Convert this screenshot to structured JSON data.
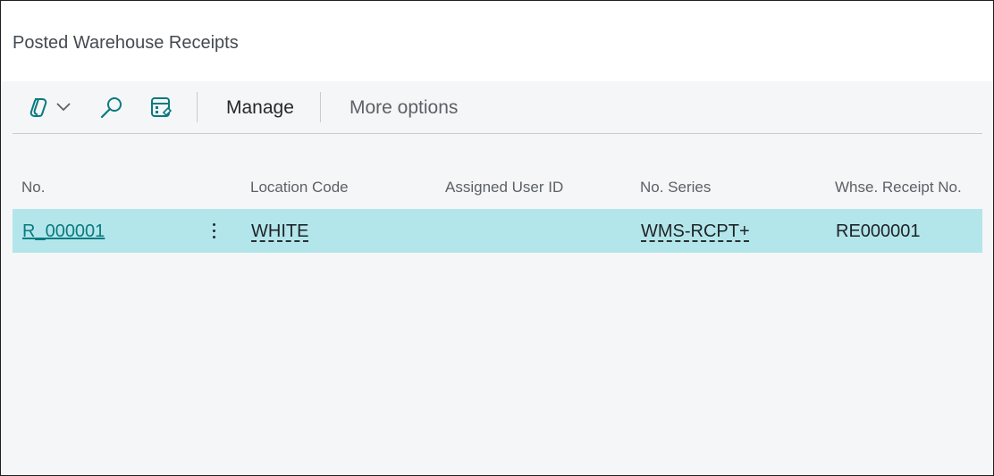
{
  "page": {
    "title": "Posted Warehouse Receipts"
  },
  "toolbar": {
    "icons": [
      "copilot-icon",
      "chevron-down-icon",
      "search-icon",
      "edit-list-icon"
    ],
    "actions": [
      {
        "label": "Manage"
      },
      {
        "label": "More options"
      }
    ]
  },
  "table": {
    "columns": [
      "No.",
      "Location Code",
      "Assigned User ID",
      "No. Series",
      "Whse. Receipt No."
    ],
    "rows": [
      {
        "no": "R_000001",
        "location_code": "WHITE",
        "assigned_user_id": "",
        "no_series": "WMS-RCPT+",
        "whse_receipt_no": "RE000001"
      }
    ]
  },
  "colors": {
    "selected_row": "#b3e6ea",
    "accent": "#0a7a80",
    "background": "#f5f6f7"
  }
}
